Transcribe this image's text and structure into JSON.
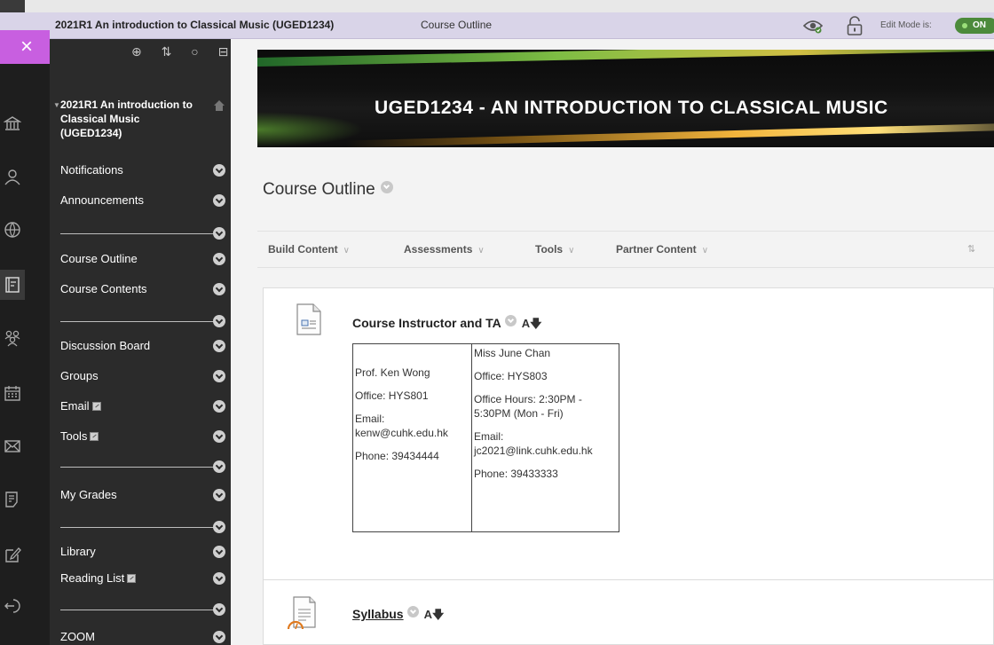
{
  "topbar": {
    "course_title": "2021R1 An introduction to Classical Music (UGED1234)",
    "breadcrumb": "Course Outline",
    "edit_mode_label": "Edit Mode is:",
    "edit_mode_value": "ON"
  },
  "close_button": "×",
  "course_menu": {
    "tool_icons": "⊕ ⇅ ○ ⊟",
    "course_name": "2021R1 An introduction to Classical Music (UGED1234)",
    "items": [
      {
        "label": "Notifications"
      },
      {
        "label": "Announcements"
      },
      {
        "label": "Course Outline"
      },
      {
        "label": "Course Contents"
      },
      {
        "label": "Discussion Board"
      },
      {
        "label": "Groups"
      },
      {
        "label": "Email"
      },
      {
        "label": "Tools"
      },
      {
        "label": "My Grades"
      },
      {
        "label": "Library"
      },
      {
        "label": "Reading List"
      },
      {
        "label": "ZOOM"
      }
    ]
  },
  "banner": {
    "title": "UGED1234 - AN INTRODUCTION TO CLASSICAL MUSIC"
  },
  "page": {
    "title": "Course Outline"
  },
  "action_bar": {
    "items": [
      "Build Content",
      "Assessments",
      "Tools",
      "Partner Content"
    ],
    "caret": "∨",
    "reorder": "⇅"
  },
  "content_items": [
    {
      "title": "Course Instructor and TA",
      "az": "A🡇",
      "instructor": {
        "name": "Prof. Ken Wong",
        "office": "Office: HYS801",
        "email_label": "Email:",
        "email": "kenw@cuhk.edu.hk",
        "phone": "Phone: 39434444"
      },
      "ta": {
        "name": "Miss June Chan",
        "office": "Office: HYS803",
        "hours": "Office Hours: 2:30PM - 5:30PM (Mon - Fri)",
        "email_label": "Email:",
        "email": "jc2021@link.cuhk.edu.hk",
        "phone": "Phone: 39433333"
      }
    },
    {
      "title": "Syllabus",
      "az": "A🡇"
    }
  ],
  "colors": {
    "topbar": "#d9d4e8",
    "close_button": "#c85fe0",
    "menu_bg": "#2b2b2b",
    "rail_bg": "#1e1e1e",
    "toggle_on": "#4c8a3b"
  }
}
